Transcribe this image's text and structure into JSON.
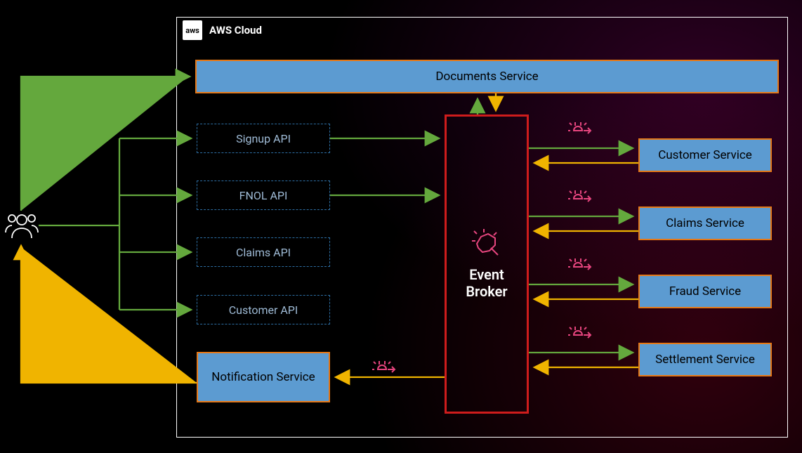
{
  "cloud": {
    "title": "AWS Cloud",
    "logo": "aws"
  },
  "documents": {
    "label": "Documents Service"
  },
  "apis": {
    "signup": {
      "label": "Signup API"
    },
    "fnol": {
      "label": "FNOL API"
    },
    "claims": {
      "label": "Claims API"
    },
    "customer": {
      "label": "Customer API"
    }
  },
  "broker": {
    "label_line1": "Event",
    "label_line2": "Broker"
  },
  "services": {
    "customer": {
      "label": "Customer Service"
    },
    "claims": {
      "label": "Claims Service"
    },
    "fraud": {
      "label": "Fraud Service"
    },
    "settlement": {
      "label": "Settlement Service"
    },
    "notification": {
      "label": "Notification Service"
    }
  },
  "colors": {
    "service_bg": "#5c9bd1",
    "service_border": "#e67817",
    "api_border": "#2d6ea3",
    "broker_border": "#ce1c1c",
    "arrow_green": "#64a83d",
    "arrow_yellow": "#f0b400",
    "event_icon": "#e6457e"
  }
}
